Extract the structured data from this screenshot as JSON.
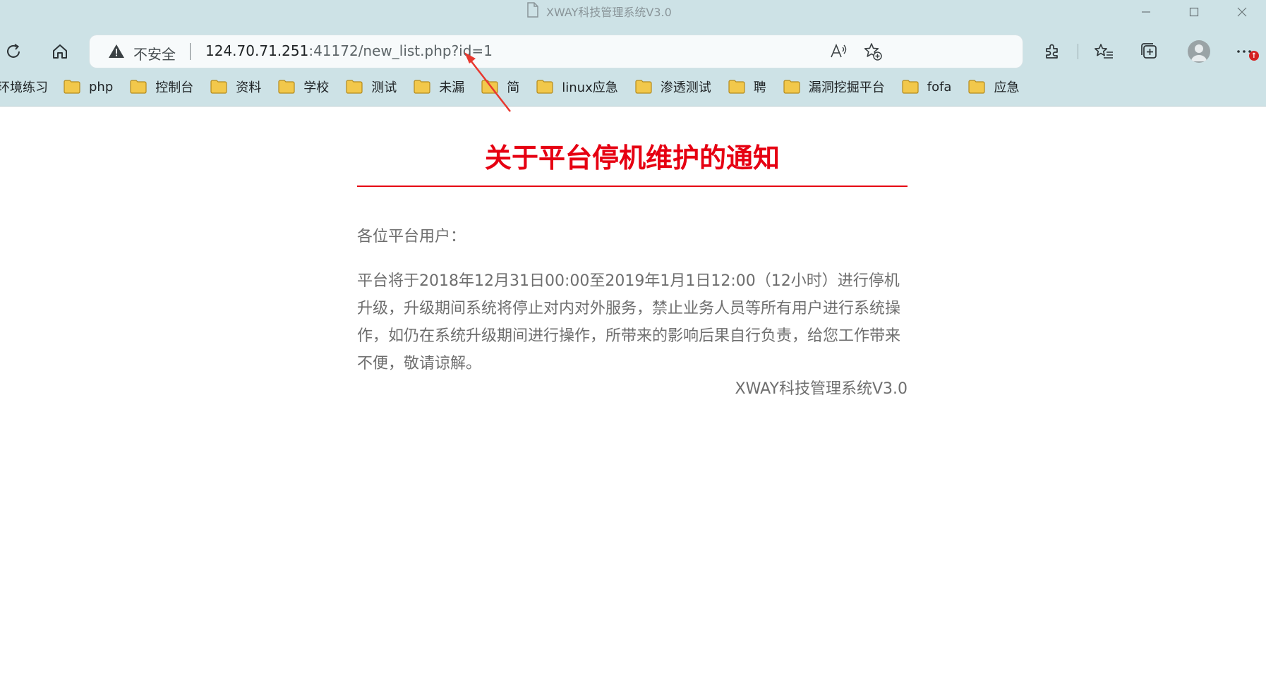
{
  "window": {
    "title": "XWAY科技管理系统V3.0"
  },
  "address_bar": {
    "security_label": "不安全",
    "url_host": "124.70.71.251",
    "url_rest": ":41172/new_list.php?id=1"
  },
  "notifications": {
    "badge": "↑"
  },
  "bookmarks": [
    {
      "label": "环境练习"
    },
    {
      "label": "php"
    },
    {
      "label": "控制台"
    },
    {
      "label": "资料"
    },
    {
      "label": "学校"
    },
    {
      "label": "测试"
    },
    {
      "label": "未漏"
    },
    {
      "label": "简"
    },
    {
      "label": "linux应急"
    },
    {
      "label": "渗透测试"
    },
    {
      "label": "聘"
    },
    {
      "label": "漏洞挖掘平台"
    },
    {
      "label": "fofa"
    },
    {
      "label": "应急"
    }
  ],
  "notice": {
    "title": "关于平台停机维护的通知",
    "greeting": "各位平台用户：",
    "body": "平台将于2018年12月31日00:00至2019年1月1日12:00（12小时）进行停机升级，升级期间系统将停止对内对外服务，禁止业务人员等所有用户进行系统操作，如仍在系统升级期间进行操作，所带来的影响后果自行负责，给您工作带来不便，敬请谅解。",
    "signature": "XWAY科技管理系统V3.0"
  },
  "colors": {
    "chrome_bg": "#cde2e6",
    "title_red": "#e60012",
    "body_gray": "#6e6e6e",
    "annotation_arrow": "#e8382f",
    "folder_yellow": "#f2c84b"
  }
}
